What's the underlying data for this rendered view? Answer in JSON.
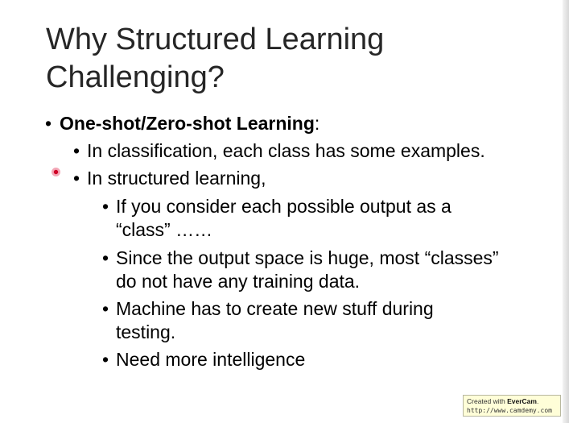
{
  "slide": {
    "title_line1": "Why Structured Learning",
    "title_line2": "Challenging?",
    "bullet_glyph": "•",
    "main_bullet": {
      "label": "One-shot/Zero-shot Learning",
      "suffix": ":"
    },
    "sub_bullets": [
      "In classification, each class has some examples.",
      "In structured learning,"
    ],
    "sub_sub_bullets": [
      {
        "line1": "If you consider each possible output as a",
        "line2": "“class” ……"
      },
      {
        "line1": "Since the output space is huge, most “classes”",
        "line2": "do not have any training data."
      },
      {
        "line1": "Machine has to create new stuff during",
        "line2": "testing."
      },
      {
        "line1": "Need more intelligence",
        "line2": ""
      }
    ]
  },
  "watermark": {
    "prefix": "Created with ",
    "brand": "EverCam",
    "suffix": ".",
    "url": "http://www.camdemy.com"
  },
  "colors": {
    "title": "#262626",
    "text": "#000000",
    "cursor": "#d0002a",
    "watermark_bg": "#fffed8"
  }
}
